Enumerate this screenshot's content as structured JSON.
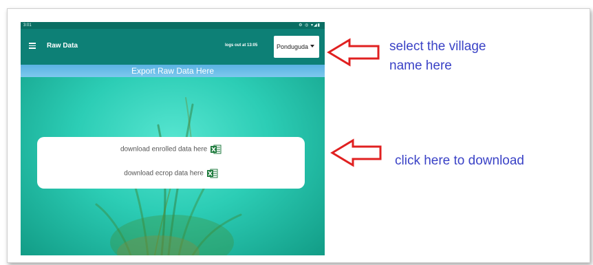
{
  "status_bar": {
    "time": "3:01",
    "icons": "⚙ ◎ ▾◢▮"
  },
  "app_bar": {
    "title": "Raw Data",
    "logout_text": "logs out at 13:05",
    "village_selected": "Ponduguda"
  },
  "export_header": "Export Raw Data Here",
  "downloads": {
    "enrolled_label": "download enrolled data here",
    "ecrop_label": "download ecrop data here"
  },
  "annotations": {
    "village_line1": "select the village",
    "village_line2": "name here",
    "download": "click here to download"
  },
  "colors": {
    "appbar": "#0d8076",
    "export_bar": "#6bbde8",
    "annotation_text": "#3a42c6",
    "arrow": "#e02020",
    "excel_green": "#1d7a3c"
  }
}
